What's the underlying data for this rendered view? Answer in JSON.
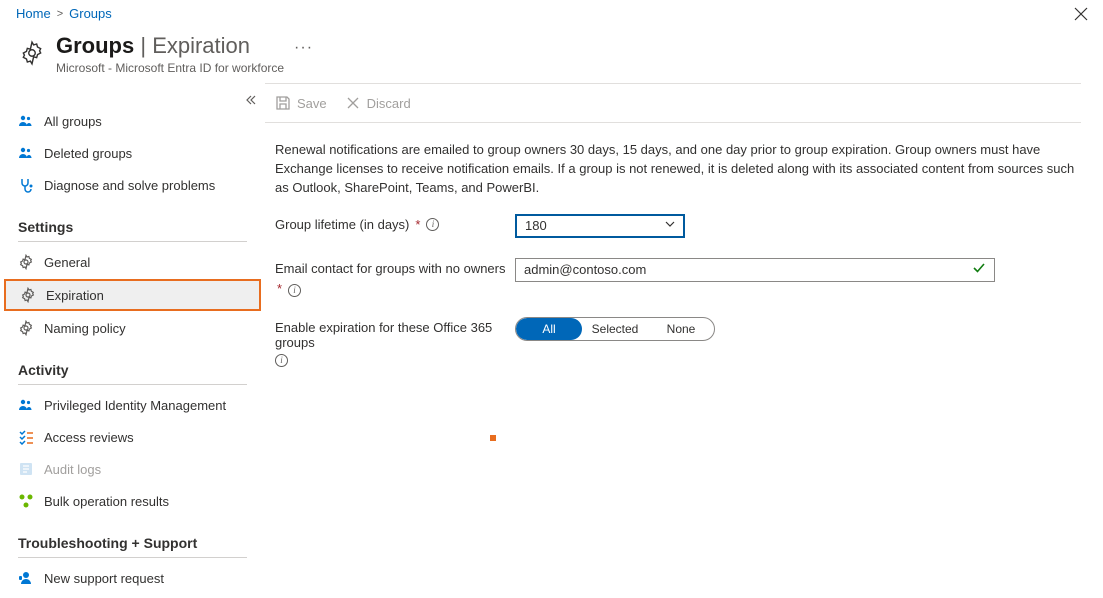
{
  "breadcrumb": {
    "home": "Home",
    "groups": "Groups"
  },
  "header": {
    "title_main": "Groups",
    "title_sep": " | ",
    "title_sub": "Expiration",
    "subtext": "Microsoft - Microsoft Entra ID for workforce"
  },
  "sidebar": {
    "all_groups": "All groups",
    "deleted_groups": "Deleted groups",
    "diagnose": "Diagnose and solve problems",
    "section_settings": "Settings",
    "general": "General",
    "expiration": "Expiration",
    "naming_policy": "Naming policy",
    "section_activity": "Activity",
    "pim": "Privileged Identity Management",
    "access_reviews": "Access reviews",
    "audit_logs": "Audit logs",
    "bulk_results": "Bulk operation results",
    "section_troubleshoot": "Troubleshooting + Support",
    "new_support": "New support request"
  },
  "toolbar": {
    "save": "Save",
    "discard": "Discard"
  },
  "info_text": "Renewal notifications are emailed to group owners 30 days, 15 days, and one day prior to group expiration. Group owners must have Exchange licenses to receive notification emails. If a group is not renewed, it is deleted along with its associated content from sources such as Outlook, SharePoint, Teams, and PowerBI.",
  "form": {
    "lifetime_label": "Group lifetime (in days)",
    "lifetime_value": "180",
    "email_label": "Email contact for groups with no owners",
    "email_value": "admin@contoso.com",
    "enable_label": "Enable expiration for these Office 365 groups",
    "opt_all": "All",
    "opt_selected": "Selected",
    "opt_none": "None"
  }
}
